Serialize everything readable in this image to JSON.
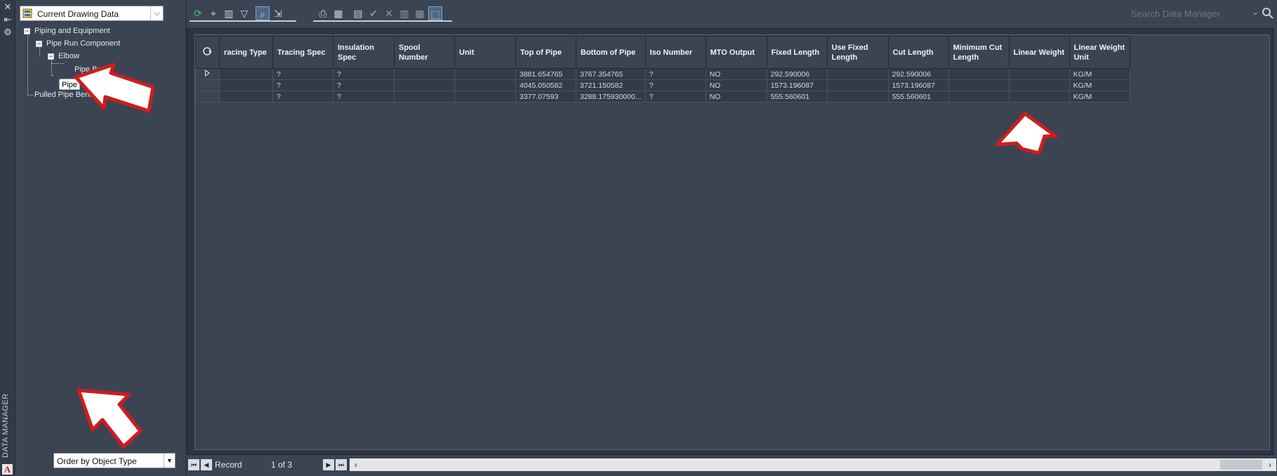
{
  "sidebar": {
    "title": "DATA MANAGER",
    "close_glyph": "✕",
    "autohide_glyph": "⇤",
    "settings_glyph": "⚙"
  },
  "left": {
    "view_select": {
      "value": "Current Drawing Data"
    },
    "tree": {
      "root": "Piping and Equipment",
      "child": "Pipe Run Component",
      "grandchild": "Elbow",
      "leaf1": "Pipe Bend",
      "leaf2_selected": "Pipe",
      "sibling": "Pulled Pipe Bend"
    },
    "order_select": {
      "value": "Order by Object Type"
    }
  },
  "toolbar": {
    "search_placeholder": "Search Data Manager"
  },
  "grid": {
    "columns": [
      "racing Type",
      "Tracing Spec",
      "Insulation Spec",
      "Spool Number",
      "Unit",
      "Top of Pipe",
      "Bottom of Pipe",
      "Iso Number",
      "MTO Output",
      "Fixed Length",
      "Use Fixed Length",
      "Cut Length",
      "Minimum Cut Length",
      "Linear Weight",
      "Linear Weight Unit"
    ],
    "rows": [
      [
        "",
        "?",
        "?",
        "",
        "",
        "3881.654765",
        "3767.354765",
        "?",
        "NO",
        "292.590006",
        "",
        "292.590006",
        "",
        "",
        "KG/M"
      ],
      [
        "",
        "?",
        "?",
        "",
        "",
        "4045.050582",
        "3721.150582",
        "?",
        "NO",
        "1573.196087",
        "",
        "1573.196087",
        "",
        "",
        "KG/M"
      ],
      [
        "",
        "?",
        "?",
        "",
        "",
        "3377.07593",
        "3288.175930000...",
        "?",
        "NO",
        "555.560601",
        "",
        "555.560601",
        "",
        "",
        "KG/M"
      ]
    ]
  },
  "status": {
    "record_label": "Record",
    "record_position": "1 of 3"
  },
  "colors": {
    "background": "#3b4453",
    "callout_fill": "#ffffff",
    "callout_stroke": "#d01c1c"
  }
}
